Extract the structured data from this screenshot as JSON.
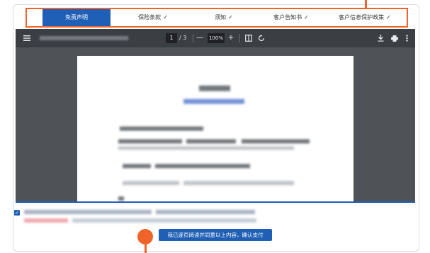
{
  "tabs": [
    {
      "label": "免责声明",
      "active": true,
      "checked": false
    },
    {
      "label": "保险条款",
      "active": false,
      "checked": true
    },
    {
      "label": "须知",
      "active": false,
      "checked": true
    },
    {
      "label": "客户告知书",
      "active": false,
      "checked": true
    },
    {
      "label": "客户信息保护政策",
      "active": false,
      "checked": true
    }
  ],
  "pdf_toolbar": {
    "page_current": "1",
    "page_total": "/ 3",
    "zoom_minus": "—",
    "zoom": "100%",
    "zoom_plus": "+"
  },
  "agreement": {
    "checked": true,
    "confirm_label": "我已逐页阅读并同意以上内容，确认支付"
  },
  "colors": {
    "accent": "#1f5fb5",
    "highlight": "#f0642a",
    "toolbar": "#3a3f44",
    "viewer_bg": "#4f5358"
  },
  "icons": [
    "menu-icon",
    "fit-page-icon",
    "rotate-icon",
    "download-icon",
    "print-icon",
    "more-icon",
    "checkmark-icon"
  ]
}
